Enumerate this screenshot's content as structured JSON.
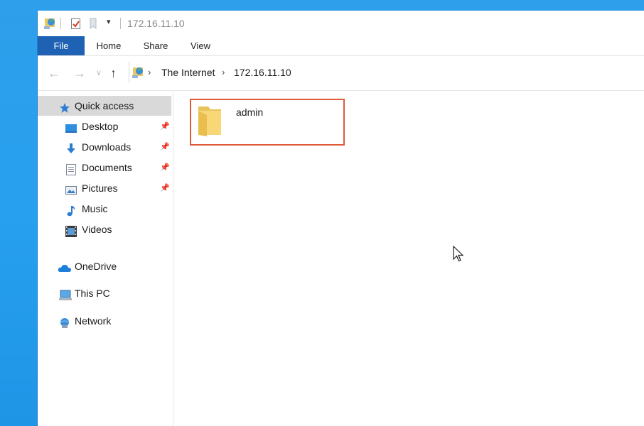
{
  "window": {
    "title": "172.16.11.10"
  },
  "ribbon": {
    "tabs": [
      "File",
      "Home",
      "Share",
      "View"
    ]
  },
  "address": {
    "crumbs": [
      "The Internet",
      "172.16.11.10"
    ]
  },
  "nav": {
    "quick_access": "Quick access",
    "items": [
      {
        "label": "Desktop",
        "icon": "desktop-icon",
        "pinned": true
      },
      {
        "label": "Downloads",
        "icon": "downloads-icon",
        "pinned": true
      },
      {
        "label": "Documents",
        "icon": "documents-icon",
        "pinned": true
      },
      {
        "label": "Pictures",
        "icon": "pictures-icon",
        "pinned": true
      },
      {
        "label": "Music",
        "icon": "music-icon",
        "pinned": false
      },
      {
        "label": "Videos",
        "icon": "videos-icon",
        "pinned": false
      }
    ],
    "onedrive": "OneDrive",
    "this_pc": "This PC",
    "network": "Network"
  },
  "content": {
    "folders": [
      {
        "name": "admin",
        "selected_highlight": true
      }
    ]
  },
  "colors": {
    "accent": "#1f62b3",
    "desktop_bg": "#27a0ef",
    "highlight_border": "#e05a3a",
    "nav_selected": "#d9d9d9"
  }
}
